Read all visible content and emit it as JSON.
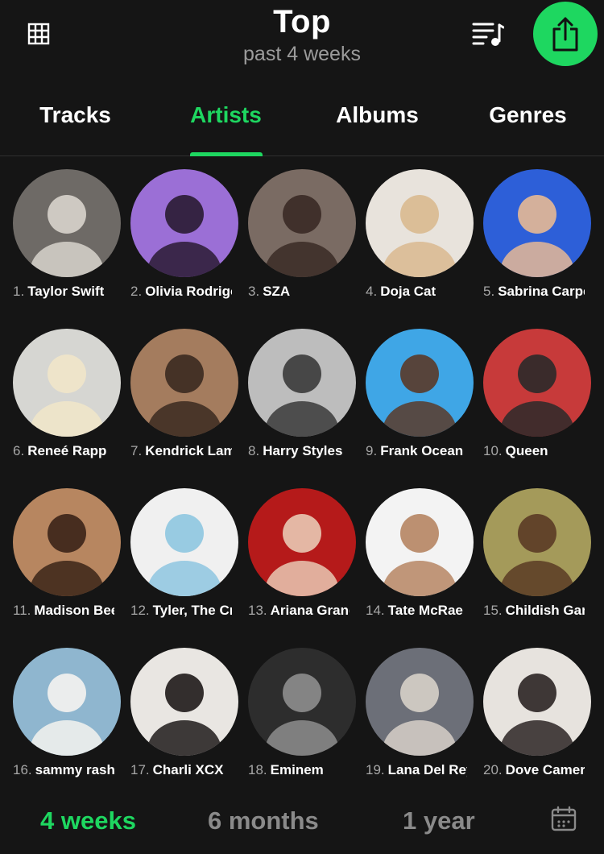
{
  "header": {
    "title": "Top",
    "subtitle": "past 4 weeks",
    "icons": {
      "left": "grid-icon",
      "queue": "queue-music-icon",
      "share": "share-icon"
    },
    "accent": "#1ed760"
  },
  "tabs": [
    {
      "label": "Tracks",
      "active": false
    },
    {
      "label": "Artists",
      "active": true
    },
    {
      "label": "Albums",
      "active": false
    },
    {
      "label": "Genres",
      "active": false
    }
  ],
  "artists": [
    {
      "rank": "1.",
      "name": "Taylor Swift",
      "bg": "#6e6a66",
      "fg": "#d8d4cc"
    },
    {
      "rank": "2.",
      "name": "Olivia Rodrigo",
      "bg": "#9b6fd6",
      "fg": "#2a1b33"
    },
    {
      "rank": "3.",
      "name": "SZA",
      "bg": "#7a6b63",
      "fg": "#3a2a25"
    },
    {
      "rank": "4.",
      "name": "Doja Cat",
      "bg": "#e8e3dc",
      "fg": "#d9b98f"
    },
    {
      "rank": "5.",
      "name": "Sabrina Carpenter",
      "bg": "#2d5fd8",
      "fg": "#e7b995"
    },
    {
      "rank": "6.",
      "name": "Reneé Rapp",
      "bg": "#d6d6d2",
      "fg": "#f1e6c9"
    },
    {
      "rank": "7.",
      "name": "Kendrick Lamar",
      "bg": "#a47c5e",
      "fg": "#3b2a20"
    },
    {
      "rank": "8.",
      "name": "Harry Styles",
      "bg": "#bdbdbd",
      "fg": "#3a3a3a"
    },
    {
      "rank": "9.",
      "name": "Frank Ocean",
      "bg": "#3fa6e6",
      "fg": "#5a3a28"
    },
    {
      "rank": "10.",
      "name": "Queen",
      "bg": "#c73a3a",
      "fg": "#2a2a2a"
    },
    {
      "rank": "11.",
      "name": "Madison Beer",
      "bg": "#b78660",
      "fg": "#3b2418"
    },
    {
      "rank": "12.",
      "name": "Tyler, The Creator",
      "bg": "#f0f0f0",
      "fg": "#8ec6e0"
    },
    {
      "rank": "13.",
      "name": "Ariana Grande",
      "bg": "#b51a1a",
      "fg": "#e9c9b4"
    },
    {
      "rank": "14.",
      "name": "Tate McRae",
      "bg": "#f3f3f3",
      "fg": "#b68563"
    },
    {
      "rank": "15.",
      "name": "Childish Gambino",
      "bg": "#a49a5a",
      "fg": "#5b3b25"
    },
    {
      "rank": "16.",
      "name": "sammy rash",
      "bg": "#8fb6cf",
      "fg": "#f5f3ef"
    },
    {
      "rank": "17.",
      "name": "Charli XCX",
      "bg": "#e9e6e2",
      "fg": "#1f1a1a"
    },
    {
      "rank": "18.",
      "name": "Eminem",
      "bg": "#2d2d2d",
      "fg": "#8e8e8e"
    },
    {
      "rank": "19.",
      "name": "Lana Del Rey",
      "bg": "#6c6f78",
      "fg": "#d7d0c8"
    },
    {
      "rank": "20.",
      "name": "Dove Cameron",
      "bg": "#e7e3de",
      "fg": "#2b2424"
    }
  ],
  "ranges": [
    {
      "label": "4 weeks",
      "active": true
    },
    {
      "label": "6 months",
      "active": false
    },
    {
      "label": "1 year",
      "active": false
    }
  ],
  "range_icon": "calendar-icon"
}
